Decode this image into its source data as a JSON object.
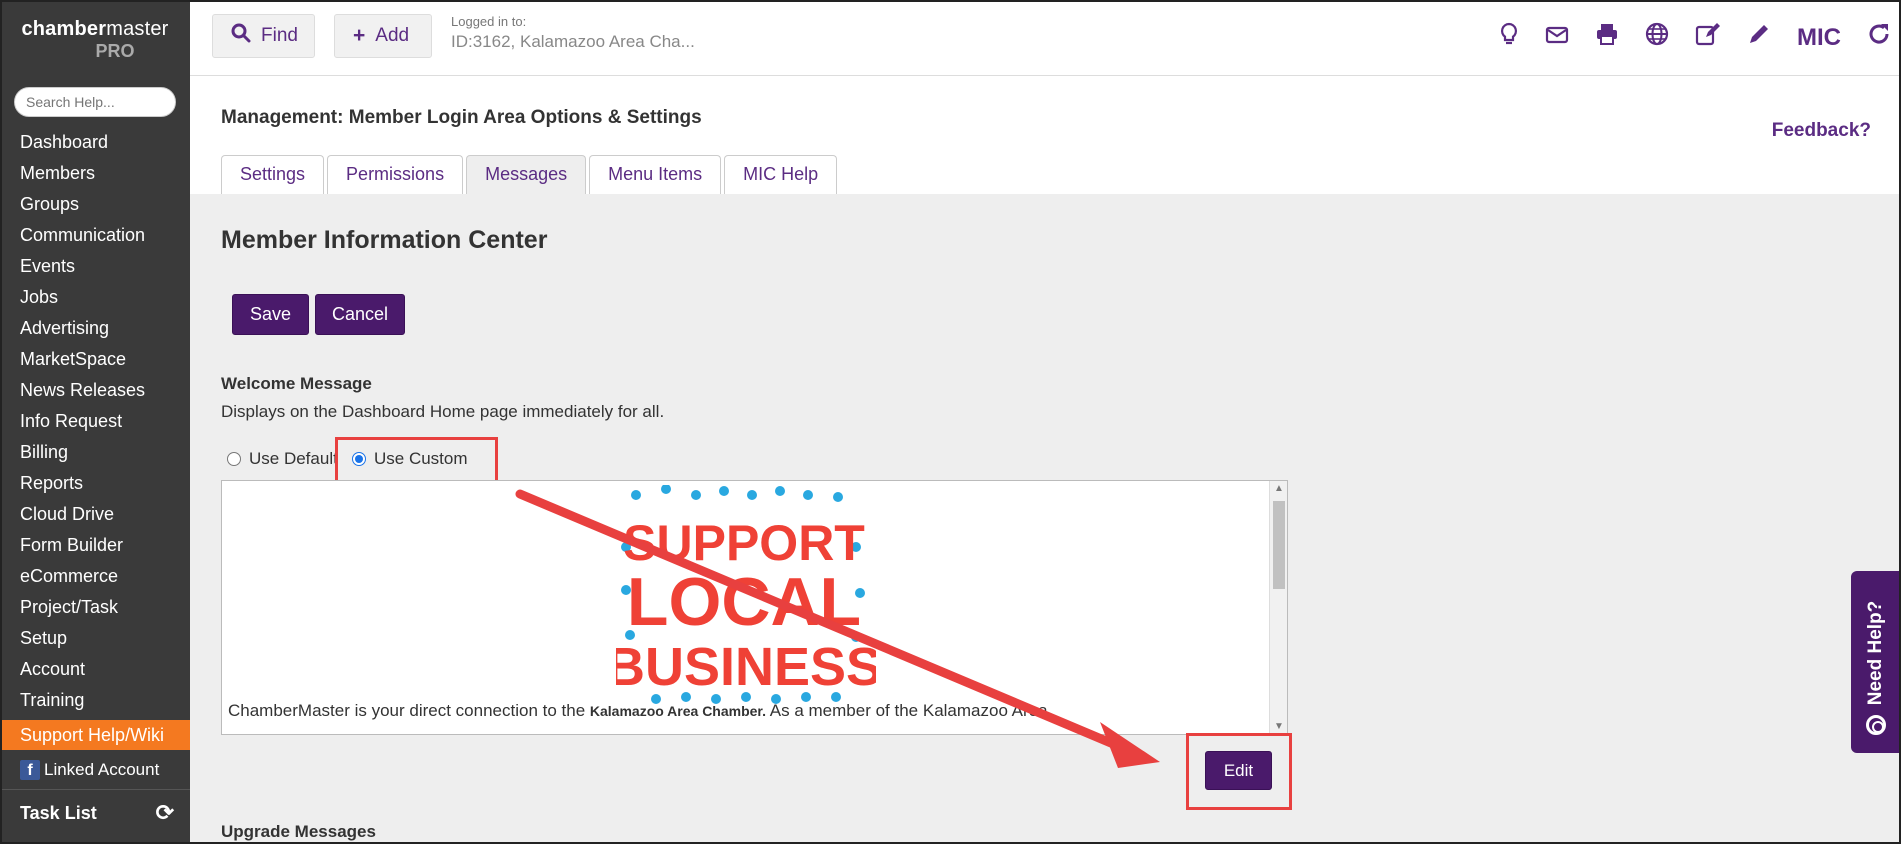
{
  "sidebar": {
    "logo_line1_bold": "chamber",
    "logo_line1_rest": "master",
    "logo_line2": "PRO",
    "search_placeholder": "Search Help...",
    "items": [
      {
        "label": "Dashboard"
      },
      {
        "label": "Members"
      },
      {
        "label": "Groups"
      },
      {
        "label": "Communication"
      },
      {
        "label": "Events"
      },
      {
        "label": "Jobs"
      },
      {
        "label": "Advertising"
      },
      {
        "label": "MarketSpace"
      },
      {
        "label": "News Releases"
      },
      {
        "label": "Info Request"
      },
      {
        "label": "Billing"
      },
      {
        "label": "Reports"
      },
      {
        "label": "Cloud Drive"
      },
      {
        "label": "Form Builder"
      },
      {
        "label": "eCommerce"
      },
      {
        "label": "Project/Task"
      },
      {
        "label": "Setup"
      },
      {
        "label": "Account"
      },
      {
        "label": "Training"
      }
    ],
    "support": "Support Help/Wiki",
    "linked_account": "Linked Account",
    "task_list": "Task List"
  },
  "topbar": {
    "find_label": "Find",
    "add_label": "Add",
    "logged_in_label": "Logged in to:",
    "logged_in_id": "ID:3162, Kalamazoo Area Cha...",
    "mic_label": "MIC"
  },
  "header": {
    "title": "Management: Member Login Area Options & Settings",
    "feedback": "Feedback?",
    "tabs": [
      {
        "label": "Settings"
      },
      {
        "label": "Permissions"
      },
      {
        "label": "Messages",
        "active": true
      },
      {
        "label": "Menu Items"
      },
      {
        "label": "MIC Help"
      }
    ]
  },
  "main": {
    "section_title": "Member Information Center",
    "save_label": "Save",
    "cancel_label": "Cancel",
    "welcome_title": "Welcome Message",
    "welcome_desc": "Displays on the Dashboard Home page immediately for all.",
    "radio_default": "Use Default",
    "radio_custom": "Use Custom",
    "selected_radio": "Use Custom",
    "image_line1": "SUPPORT",
    "image_line2": "LOCAL",
    "image_line3": "BUSINESS",
    "editor_text_a": "ChamberMaster is your direct connection to the ",
    "editor_text_b": "Kalamazoo Area Chamber.",
    "editor_text_c": " As a member of the Kalamazoo Area",
    "edit_label": "Edit",
    "upgrade_title": "Upgrade Messages"
  },
  "need_help": "Need Help?",
  "colors": {
    "brand_purple": "#4a1a6b",
    "accent_orange": "#f47920",
    "highlight_red": "#e8403f",
    "image_red": "#ef4136",
    "image_dots": "#29a8e0"
  }
}
